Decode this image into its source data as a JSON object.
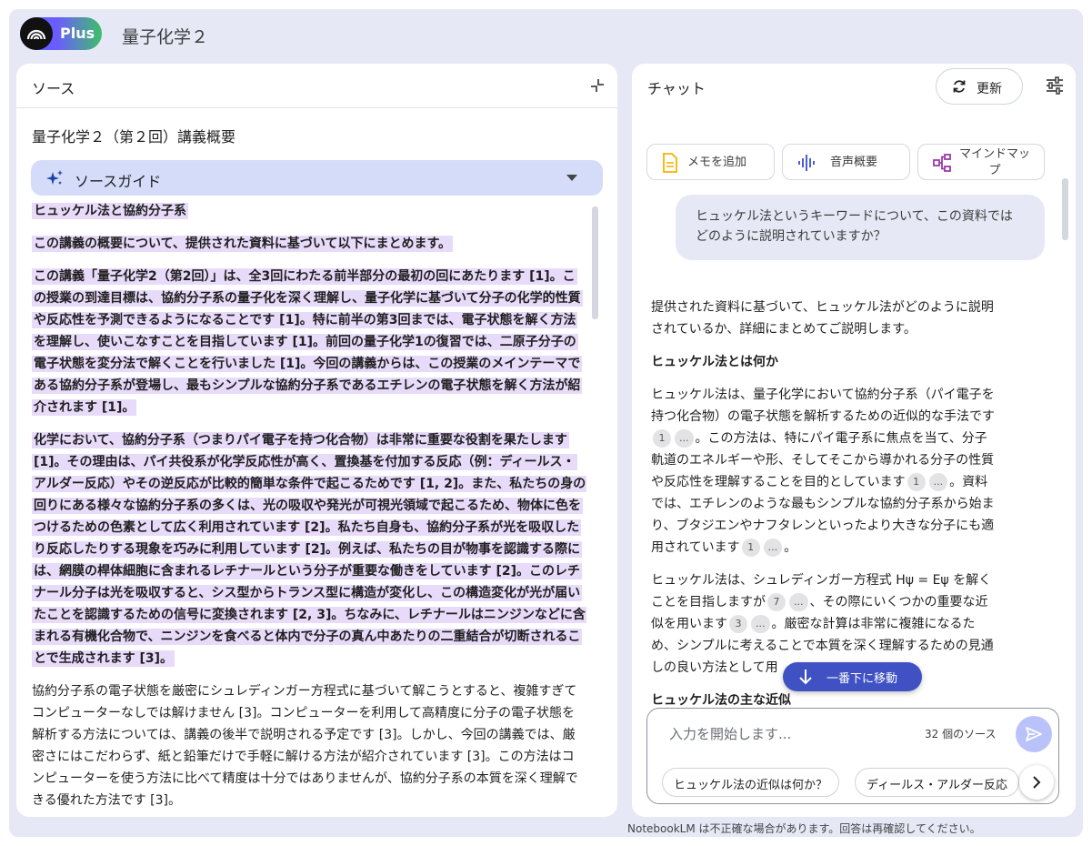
{
  "app": {
    "plan_badge": "Plus",
    "notebook_title": "量子化学２",
    "footer_note": "NotebookLM は不正確な場合があります。回答は再確認してください。"
  },
  "sources": {
    "title": "ソース",
    "doc_title": "量子化学２（第２回）講義概要",
    "guide_label": "ソースガイド",
    "paragraphs": [
      {
        "text": "ヒュッケル法と協約分子系",
        "highlight": true
      },
      {
        "text": "この講義の概要について、提供された資料に基づいて以下にまとめます。",
        "highlight": true
      },
      {
        "text": "この講義「量子化学2（第2回）」は、全3回にわたる前半部分の最初の回にあたります [1]。この授業の到達目標は、協約分子系の量子化を深く理解し、量子化学に基づいて分子の化学的性質や反応性を予測できるようになることです [1]。特に前半の第3回までは、電子状態を解く方法を理解し、使いこなすことを目指しています [1]。前回の量子化学1の復習では、二原子分子の電子状態を変分法で解くことを行いました [1]。今回の講義からは、この授業のメインテーマである協約分子系が登場し、最もシンプルな協約分子系であるエチレンの電子状態を解く方法が紹介されます [1]。",
        "highlight": true
      },
      {
        "text": "化学において、協約分子系（つまりパイ電子を持つ化合物）は非常に重要な役割を果たします [1]。その理由は、パイ共役系が化学反応性が高く、置換基を付加する反応（例：ディールス・アルダー反応）やその逆反応が比較的簡単な条件で起こるためです [1, 2]。また、私たちの身の回りにある様々な協約分子系の多くは、光の吸収や発光が可視光領域で起こるため、物体に色をつけるための色素として広く利用されています [2]。私たち自身も、協約分子系が光を吸収したり反応したりする現象を巧みに利用しています [2]。例えば、私たちの目が物事を認識する際には、網膜の桿体細胞に含まれるレチナールという分子が重要な働きをしています [2]。このレチナール分子は光を吸収すると、シス型からトランス型に構造が変化し、この構造変化が光が届いたことを認識するための信号に変換されます [2, 3]。ちなみに、レチナールはニンジンなどに含まれる有機化合物で、ニンジンを食べると体内で分子の真ん中あたりの二重結合が切断されることで生成されます [3]。",
        "highlight": true
      },
      {
        "text": "協約分子系の電子状態を厳密にシュレディンガー方程式に基づいて解こうとすると、複雑すぎてコンピューターなしでは解けません [3]。コンピューターを利用して高精度に分子の電子状態を解析する方法については、講義の後半で説明される予定です [3]。しかし、今回の講義では、厳密さにはこだわらず、紙と鉛筆だけで手軽に解ける方法が紹介されています [3]。この方法はコンピューターを使う方法に比べて精度は十分ではありませんが、協約分子系の本質を深く理解できる優れた方法です [3]。",
        "highlight": false
      }
    ]
  },
  "chat": {
    "title": "チャット",
    "refresh_label": "更新",
    "chips": [
      {
        "label": "メモを追加",
        "icon": "note-icon",
        "color": "#f4b400"
      },
      {
        "label": "音声概要",
        "icon": "audio-wave-icon",
        "color": "#4b5fd6"
      },
      {
        "label": "マインドマップ",
        "icon": "mindmap-icon",
        "color": "#9c3aa8"
      }
    ],
    "user_question": "ヒュッケル法というキーワードについて、この資料ではどのように説明されていますか？",
    "answer": {
      "intro": "提供された資料に基づいて、ヒュッケル法がどのように説明されているか、詳細にまとめてご説明します。",
      "heading1": "ヒュッケル法とは何か",
      "p1_a": "ヒュッケル法は、量子化学において協約分子系（パイ電子を持つ化合物）の電子状態を解析するための近似的な手法です",
      "p1_b": "。この方法は、特にパイ電子系に焦点を当て、分子軌道のエネルギーや形、そしてそこから導かれる分子の性質や反応性を理解することを目的としています",
      "p1_c": "。資料では、エチレンのような最もシンプルな協約分子系から始まり、ブタジエンやナフタレンといったより大きな分子にも適用されています",
      "p1_d": "。",
      "p2_a": "ヒュッケル法は、シュレディンガー方程式 Hψ = Eψ を解くことを目指しますが",
      "p2_b": "、その際にいくつかの重要な近似を用います",
      "p2_c": "。厳密な計算は非常に複雑になるため、シンプルに考えることで本質を深く理解するための見通しの良い方法として用",
      "heading2": "ヒュッケル法の主な近似",
      "cites": [
        "1",
        "...",
        "1",
        "...",
        "1",
        "...",
        "7",
        "...",
        "3",
        "..."
      ]
    },
    "jump_label": "一番下に移動",
    "input_placeholder": "入力を開始します...",
    "source_count": "32 個のソース",
    "suggestions": [
      "ヒュッケル法の近似は何か？",
      "ディールス・アルダー反応"
    ]
  }
}
